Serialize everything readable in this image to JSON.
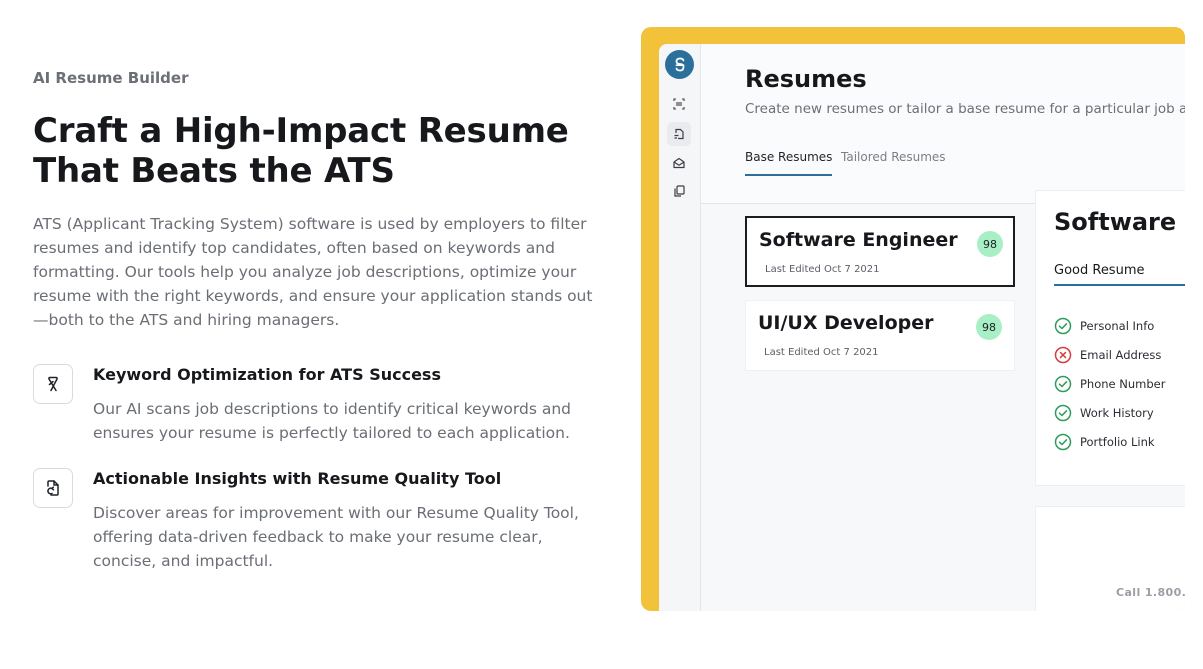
{
  "hero": {
    "eyebrow": "AI Resume Builder",
    "headline": "Craft a High-Impact Resume That Beats the ATS",
    "lede": "ATS (Applicant Tracking System) software is used by employers to filter resumes and identify top candidates, often based on keywords and formatting. Our tools help you analyze job descriptions, optimize your resume with the right keywords, and ensure your application stands out—both to the ATS and hiring managers."
  },
  "features": [
    {
      "icon": "ribbon-icon",
      "title": "Keyword Optimization for ATS Success",
      "desc": "Our AI scans job descriptions to identify critical keywords and ensures your resume is perfectly tailored to each application."
    },
    {
      "icon": "document-refresh-icon",
      "title": "Actionable Insights with Resume Quality Tool",
      "desc": "Discover areas for improvement with our Resume Quality Tool, offering data-driven feedback to make your resume clear, concise, and impactful."
    }
  ],
  "app": {
    "frame_color": "#f2c23b",
    "accent": "#2b6f9b",
    "title": "Resumes",
    "subtitle": "Create new resumes or tailor a base resume for a particular job applicati",
    "tabs": [
      {
        "label": "Base Resumes",
        "active": true
      },
      {
        "label": "Tailored Resumes",
        "active": false
      }
    ],
    "rail_icons": [
      "scan-icon",
      "resume-file-icon",
      "mail-icon",
      "copy-documents-icon"
    ],
    "resumes": [
      {
        "name": "Software Engineer",
        "edited": "Last Edited Oct 7 2021",
        "score": "98",
        "selected": true
      },
      {
        "name": "UI/UX Developer",
        "edited": "Last Edited Oct 7 2021",
        "score": "98",
        "selected": false
      }
    ],
    "detail": {
      "title": "Software En",
      "section": "Good Resume",
      "checks": [
        {
          "label": "Personal Info",
          "status": "pass"
        },
        {
          "label": "Email Address",
          "status": "fail"
        },
        {
          "label": "Phone Number",
          "status": "pass"
        },
        {
          "label": "Work History",
          "status": "pass"
        },
        {
          "label": "Portfolio Link",
          "status": "pass"
        }
      ],
      "pass_color": "#2e9b5b",
      "fail_color": "#d83a3a"
    },
    "preview_text": "Call 1.800."
  }
}
